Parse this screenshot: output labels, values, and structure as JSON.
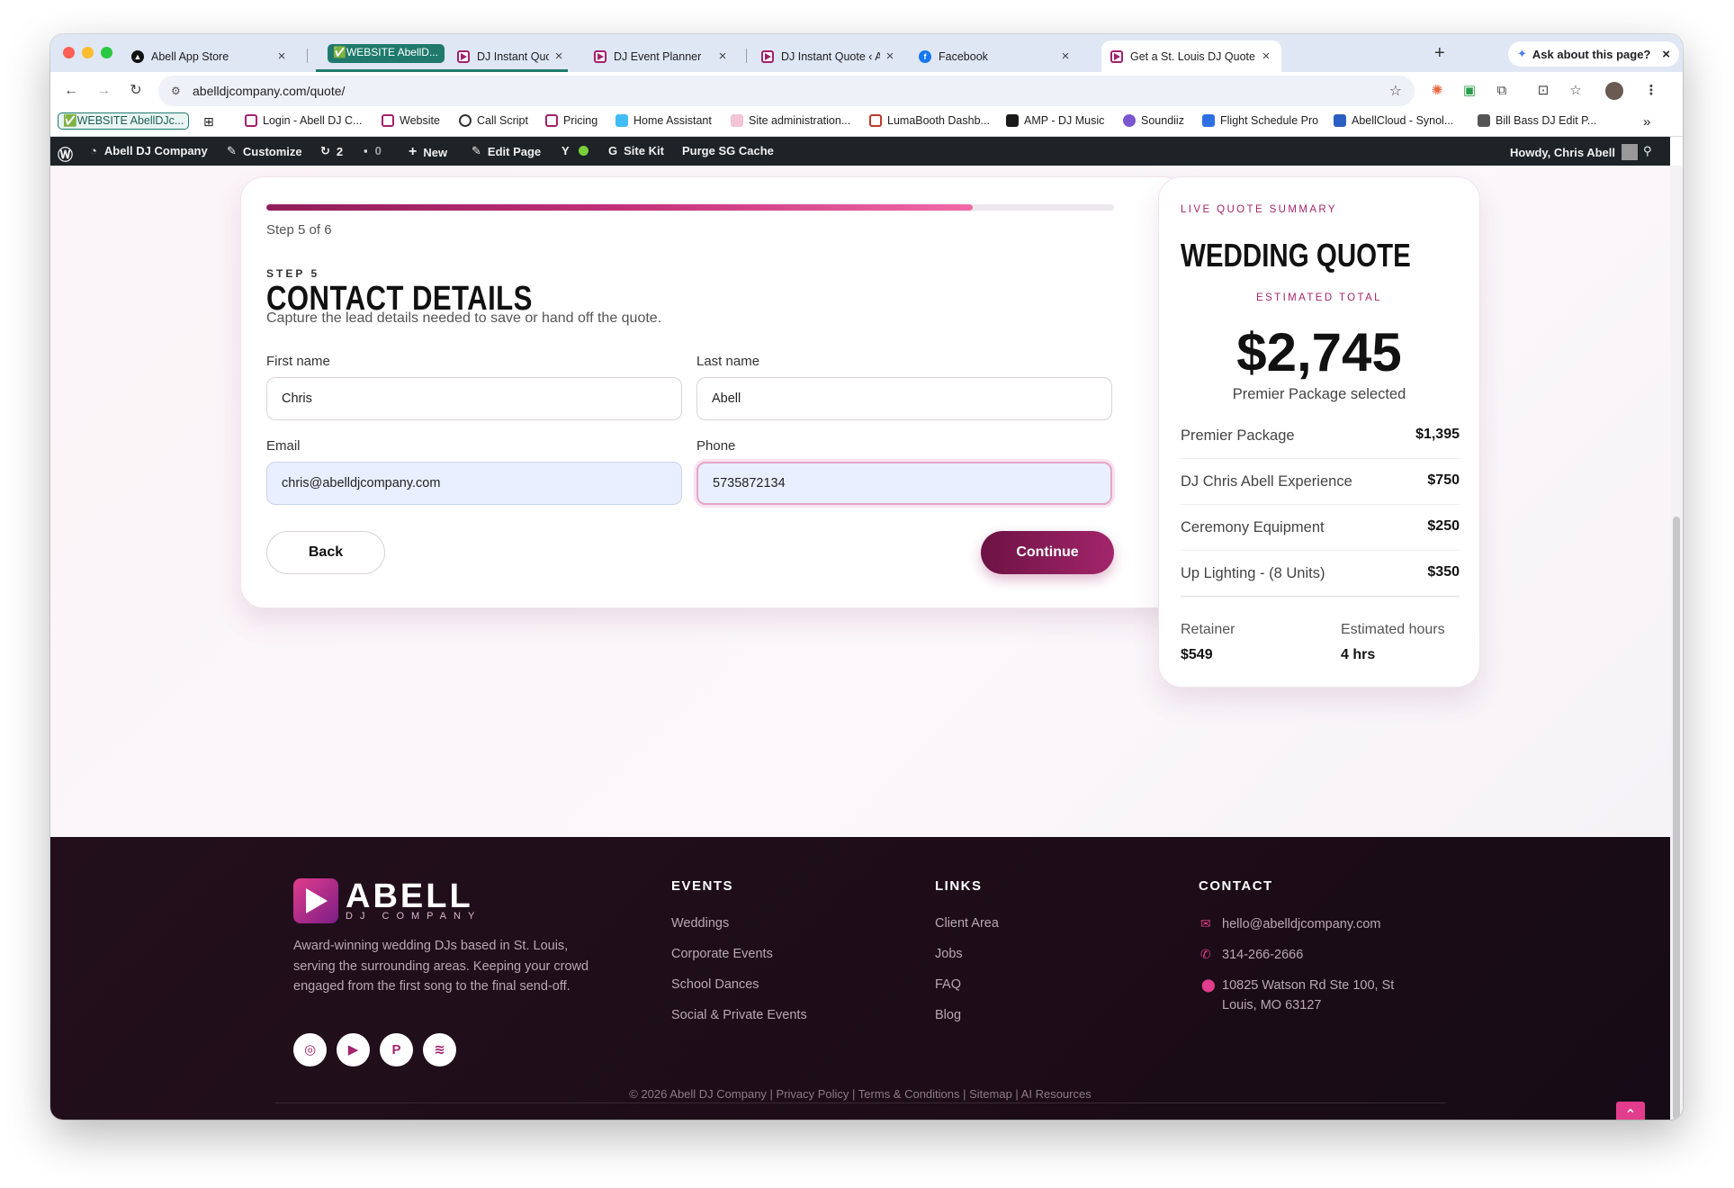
{
  "browser": {
    "tabs": [
      {
        "title": "Abell App Store"
      },
      {
        "title": "DJ Instant Quote ‹ Abell D"
      },
      {
        "title": "DJ Event Planner"
      },
      {
        "title": "DJ Instant Quote ‹ Abell D"
      },
      {
        "title": "Facebook"
      },
      {
        "title": "Get a St. Louis DJ Quote |"
      }
    ],
    "group_label": "✅WEBSITE AbellD...",
    "ask_label": "Ask about this page?",
    "url": "abelldjcompany.com/quote/",
    "bookmarks": [
      "✅WEBSITE AbellDJc...",
      "Login - Abell DJ C...",
      "Website",
      "Call Script",
      "Pricing",
      "Home Assistant",
      "Site administration...",
      "LumaBooth Dashb...",
      "AMP - DJ Music",
      "Soundiiz",
      "Flight Schedule Pro",
      "AbellCloud - Synol...",
      "Bill Bass DJ Edit P..."
    ],
    "more_bookmarks": "»"
  },
  "wp_admin": {
    "site": "Abell DJ Company",
    "customize": "Customize",
    "updates": "2",
    "comments": "0",
    "new": "New",
    "edit_page": "Edit Page",
    "site_kit": "Site Kit",
    "purge": "Purge SG Cache",
    "howdy": "Howdy, Chris Abell"
  },
  "form": {
    "progress": 0.833,
    "step_count": "Step 5 of 6",
    "eyebrow": "STEP 5",
    "title": "CONTACT DETAILS",
    "subtitle": "Capture the lead details needed to save or hand off the quote.",
    "first_name_label": "First name",
    "first_name_value": "Chris",
    "last_name_label": "Last name",
    "last_name_value": "Abell",
    "email_label": "Email",
    "email_value": "chris@abelldjcompany.com",
    "phone_label": "Phone",
    "phone_value": "5735872134",
    "back_label": "Back",
    "continue_label": "Continue"
  },
  "summary": {
    "eyebrow": "LIVE QUOTE SUMMARY",
    "title": "WEDDING QUOTE",
    "estimated_label": "ESTIMATED TOTAL",
    "total": "$2,745",
    "package_selected": "Premier Package selected",
    "items": [
      {
        "name": "Premier Package",
        "price": "$1,395"
      },
      {
        "name": "DJ Chris Abell Experience",
        "price": "$750"
      },
      {
        "name": "Ceremony Equipment",
        "price": "$250"
      },
      {
        "name": "Up Lighting - (8 Units)",
        "price": "$350"
      }
    ],
    "retainer_label": "Retainer",
    "retainer_value": "$549",
    "hours_label": "Estimated hours",
    "hours_value": "4 hrs"
  },
  "footer": {
    "logo_big": "ABELL",
    "logo_small": "DJ COMPANY",
    "description": "Award-winning wedding DJs based in St. Louis, serving the surrounding areas. Keeping your crowd engaged from the first song to the final send-off.",
    "events_head": "EVENTS",
    "events": [
      "Weddings",
      "Corporate Events",
      "School Dances",
      "Social & Private Events"
    ],
    "links_head": "LINKS",
    "links": [
      "Client Area",
      "Jobs",
      "FAQ",
      "Blog"
    ],
    "contact_head": "CONTACT",
    "email": "hello@abelldjcompany.com",
    "phone": "314-266-2666",
    "address": "10825 Watson Rd Ste 100, St Louis, MO 63127",
    "copyright": "© 2026 Abell DJ Company | Privacy Policy | Terms & Conditions | Sitemap | AI Resources"
  },
  "colors": {
    "accent": "#a3256b",
    "accent_dark": "#6c1244",
    "footer_bg": "#1d0d18"
  },
  "icons": [
    "wordpress-icon",
    "dashboard-icon",
    "brush-icon",
    "refresh-icon",
    "comment-icon",
    "plus-icon",
    "pencil-icon",
    "yoast-icon",
    "google-icon",
    "search-icon",
    "instagram-icon",
    "youtube-icon",
    "pinterest-icon",
    "spotify-icon",
    "mail-icon",
    "phone-icon",
    "location-icon",
    "arrow-up-icon"
  ]
}
